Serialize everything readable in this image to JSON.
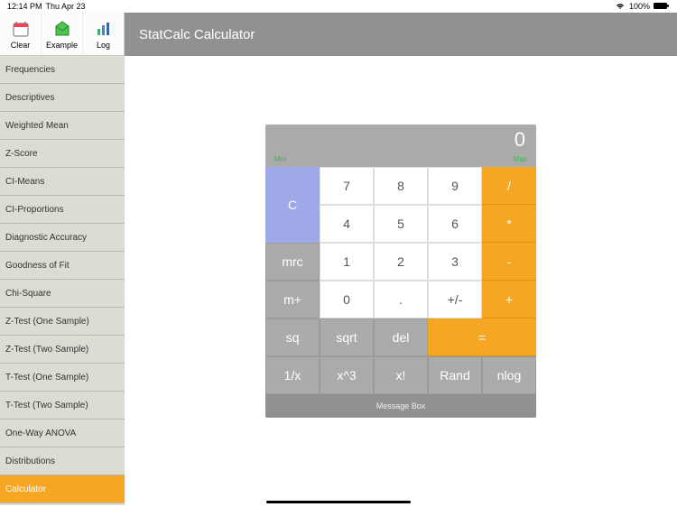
{
  "status": {
    "time": "12:14 PM",
    "date": "Thu Apr 23",
    "battery": "100%"
  },
  "toolbar": {
    "clear": "Clear",
    "example": "Example",
    "log": "Log"
  },
  "header": {
    "title": "StatCalc Calculator"
  },
  "sidebar": {
    "items": [
      "Frequencies",
      "Descriptives",
      "Weighted Mean",
      "Z-Score",
      "CI-Means",
      "CI-Proportions",
      "Diagnostic Accuracy",
      "Goodness of Fit",
      "Chi-Square",
      "Z-Test (One Sample)",
      "Z-Test (Two Sample)",
      "T-Test (One Sample)",
      "T-Test (Two Sample)",
      "One-Way ANOVA",
      "Distributions",
      "Calculator"
    ],
    "active_index": 15
  },
  "calc": {
    "display": "0",
    "label_left": "Min",
    "label_right": "Max",
    "msg": "Message Box",
    "keys": {
      "C": "C",
      "7": "7",
      "8": "8",
      "9": "9",
      "div": "/",
      "4": "4",
      "5": "5",
      "6": "6",
      "mul": "*",
      "mrc": "mrc",
      "1": "1",
      "2": "2",
      "3": "3",
      "sub": "-",
      "mplus": "m+",
      "0": "0",
      "dot": ".",
      "pm": "+/-",
      "add": "+",
      "sq": "sq",
      "sqrt": "sqrt",
      "del": "del",
      "eq": "=",
      "inv": "1/x",
      "cube": "x^3",
      "fact": "x!",
      "rand": "Rand",
      "nlog": "nlog"
    }
  }
}
